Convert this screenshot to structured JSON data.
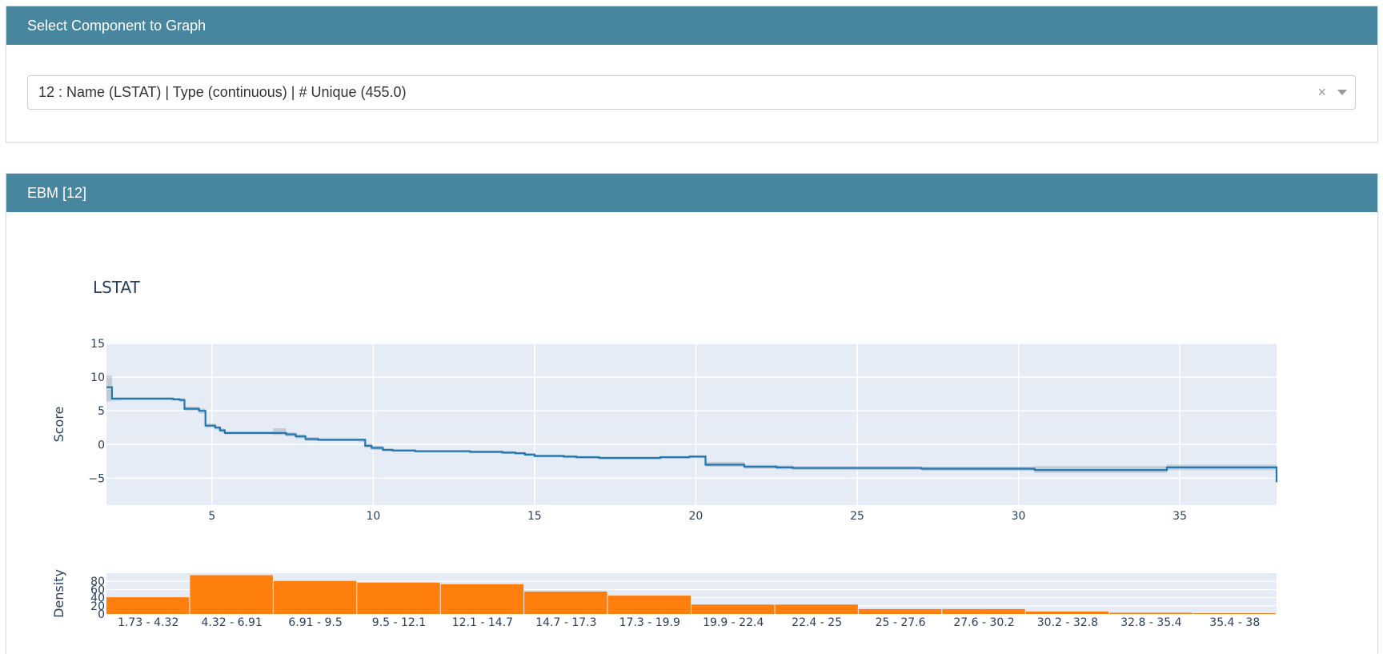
{
  "selector_card": {
    "title": "Select Component to Graph",
    "selected": "12 : Name (LSTAT) | Type (continuous) | # Unique (455.0)",
    "clear_glyph": "×"
  },
  "plot_card": {
    "title": "EBM [12]"
  },
  "colors": {
    "header_bg": "#47869e",
    "plot_bg": "#e5ecf6",
    "line": "#1f77b4",
    "band": "#9ca3ab",
    "bar": "#ff7f0e"
  },
  "chart_data": [
    {
      "type": "line",
      "title": "LSTAT",
      "xlabel": "",
      "ylabel": "Score",
      "xlim": [
        1.73,
        38
      ],
      "ylim": [
        -9,
        15
      ],
      "xticks": [
        5,
        10,
        15,
        20,
        25,
        30,
        35
      ],
      "yticks": [
        15,
        10,
        5,
        0,
        -5
      ],
      "ytick_labels": [
        "15",
        "10",
        "5",
        "0",
        "−5"
      ],
      "grid": true,
      "line_shape": "step",
      "x": [
        1.73,
        1.9,
        2.2,
        3.0,
        3.8,
        4.0,
        4.15,
        4.6,
        4.8,
        5.1,
        5.25,
        5.4,
        6.0,
        6.9,
        7.3,
        7.6,
        7.9,
        8.3,
        9.55,
        9.75,
        9.95,
        10.3,
        10.6,
        11.3,
        12.0,
        13.0,
        14.0,
        14.4,
        14.7,
        15.0,
        15.9,
        16.3,
        17.0,
        18.5,
        18.9,
        19.8,
        20.3,
        21.0,
        21.5,
        22.5,
        23.0,
        25.0,
        27.0,
        29.6,
        30.5,
        34.0,
        34.6,
        38.0
      ],
      "y": [
        8.5,
        6.8,
        6.8,
        6.8,
        6.7,
        6.6,
        5.3,
        5.0,
        2.8,
        2.5,
        2.1,
        1.7,
        1.7,
        1.7,
        1.5,
        1.2,
        0.8,
        0.7,
        0.7,
        -0.2,
        -0.5,
        -0.8,
        -0.9,
        -1.0,
        -1.0,
        -1.1,
        -1.2,
        -1.3,
        -1.5,
        -1.7,
        -1.8,
        -1.9,
        -2.0,
        -2.0,
        -1.9,
        -1.8,
        -3.0,
        -3.0,
        -3.3,
        -3.4,
        -3.5,
        -3.5,
        -3.6,
        -3.6,
        -3.8,
        -3.8,
        -3.4,
        -5.6
      ],
      "band_lower": [
        6.4,
        6.5,
        6.6,
        6.6,
        6.5,
        6.3,
        5.0,
        4.6,
        2.5,
        2.2,
        1.8,
        1.5,
        1.5,
        1.4,
        1.2,
        0.9,
        0.5,
        0.5,
        0.4,
        -0.5,
        -0.8,
        -1.0,
        -1.1,
        -1.2,
        -1.2,
        -1.3,
        -1.4,
        -1.5,
        -1.7,
        -1.9,
        -2.0,
        -2.1,
        -2.2,
        -2.2,
        -2.1,
        -2.0,
        -3.3,
        -3.3,
        -3.6,
        -3.7,
        -3.8,
        -3.8,
        -3.9,
        -3.9,
        -4.2,
        -4.2,
        -3.8,
        -9.0
      ],
      "band_upper": [
        10.2,
        7.0,
        7.0,
        7.0,
        6.9,
        6.9,
        5.6,
        5.3,
        3.1,
        2.8,
        2.4,
        1.9,
        1.9,
        2.4,
        1.8,
        1.5,
        1.1,
        0.9,
        0.9,
        0.1,
        -0.2,
        -0.6,
        -0.7,
        -0.8,
        -0.8,
        -0.9,
        -1.0,
        -1.1,
        -1.3,
        -1.5,
        -1.6,
        -1.7,
        -1.8,
        -1.8,
        -1.7,
        -1.6,
        -2.6,
        -2.6,
        -3.0,
        -3.1,
        -3.2,
        -3.2,
        -3.3,
        -3.3,
        -3.2,
        -3.2,
        -3.0,
        -2.4
      ]
    },
    {
      "type": "bar",
      "xlabel": "",
      "ylabel": "Density",
      "ylim": [
        0,
        100
      ],
      "yticks": [
        0,
        20,
        40,
        60,
        80
      ],
      "categories": [
        "1.73 - 4.32",
        "4.32 - 6.91",
        "6.91 - 9.5",
        "9.5 - 12.1",
        "12.1 - 14.7",
        "14.7 - 17.3",
        "17.3 - 19.9",
        "19.9 - 22.4",
        "22.4 - 25",
        "25 - 27.6",
        "27.6 - 30.2",
        "30.2 - 32.8",
        "32.8 - 35.4",
        "35.4 - 38"
      ],
      "values": [
        41,
        95,
        81,
        77,
        73,
        55,
        45,
        23,
        23,
        12,
        12,
        6,
        3,
        2
      ]
    }
  ]
}
